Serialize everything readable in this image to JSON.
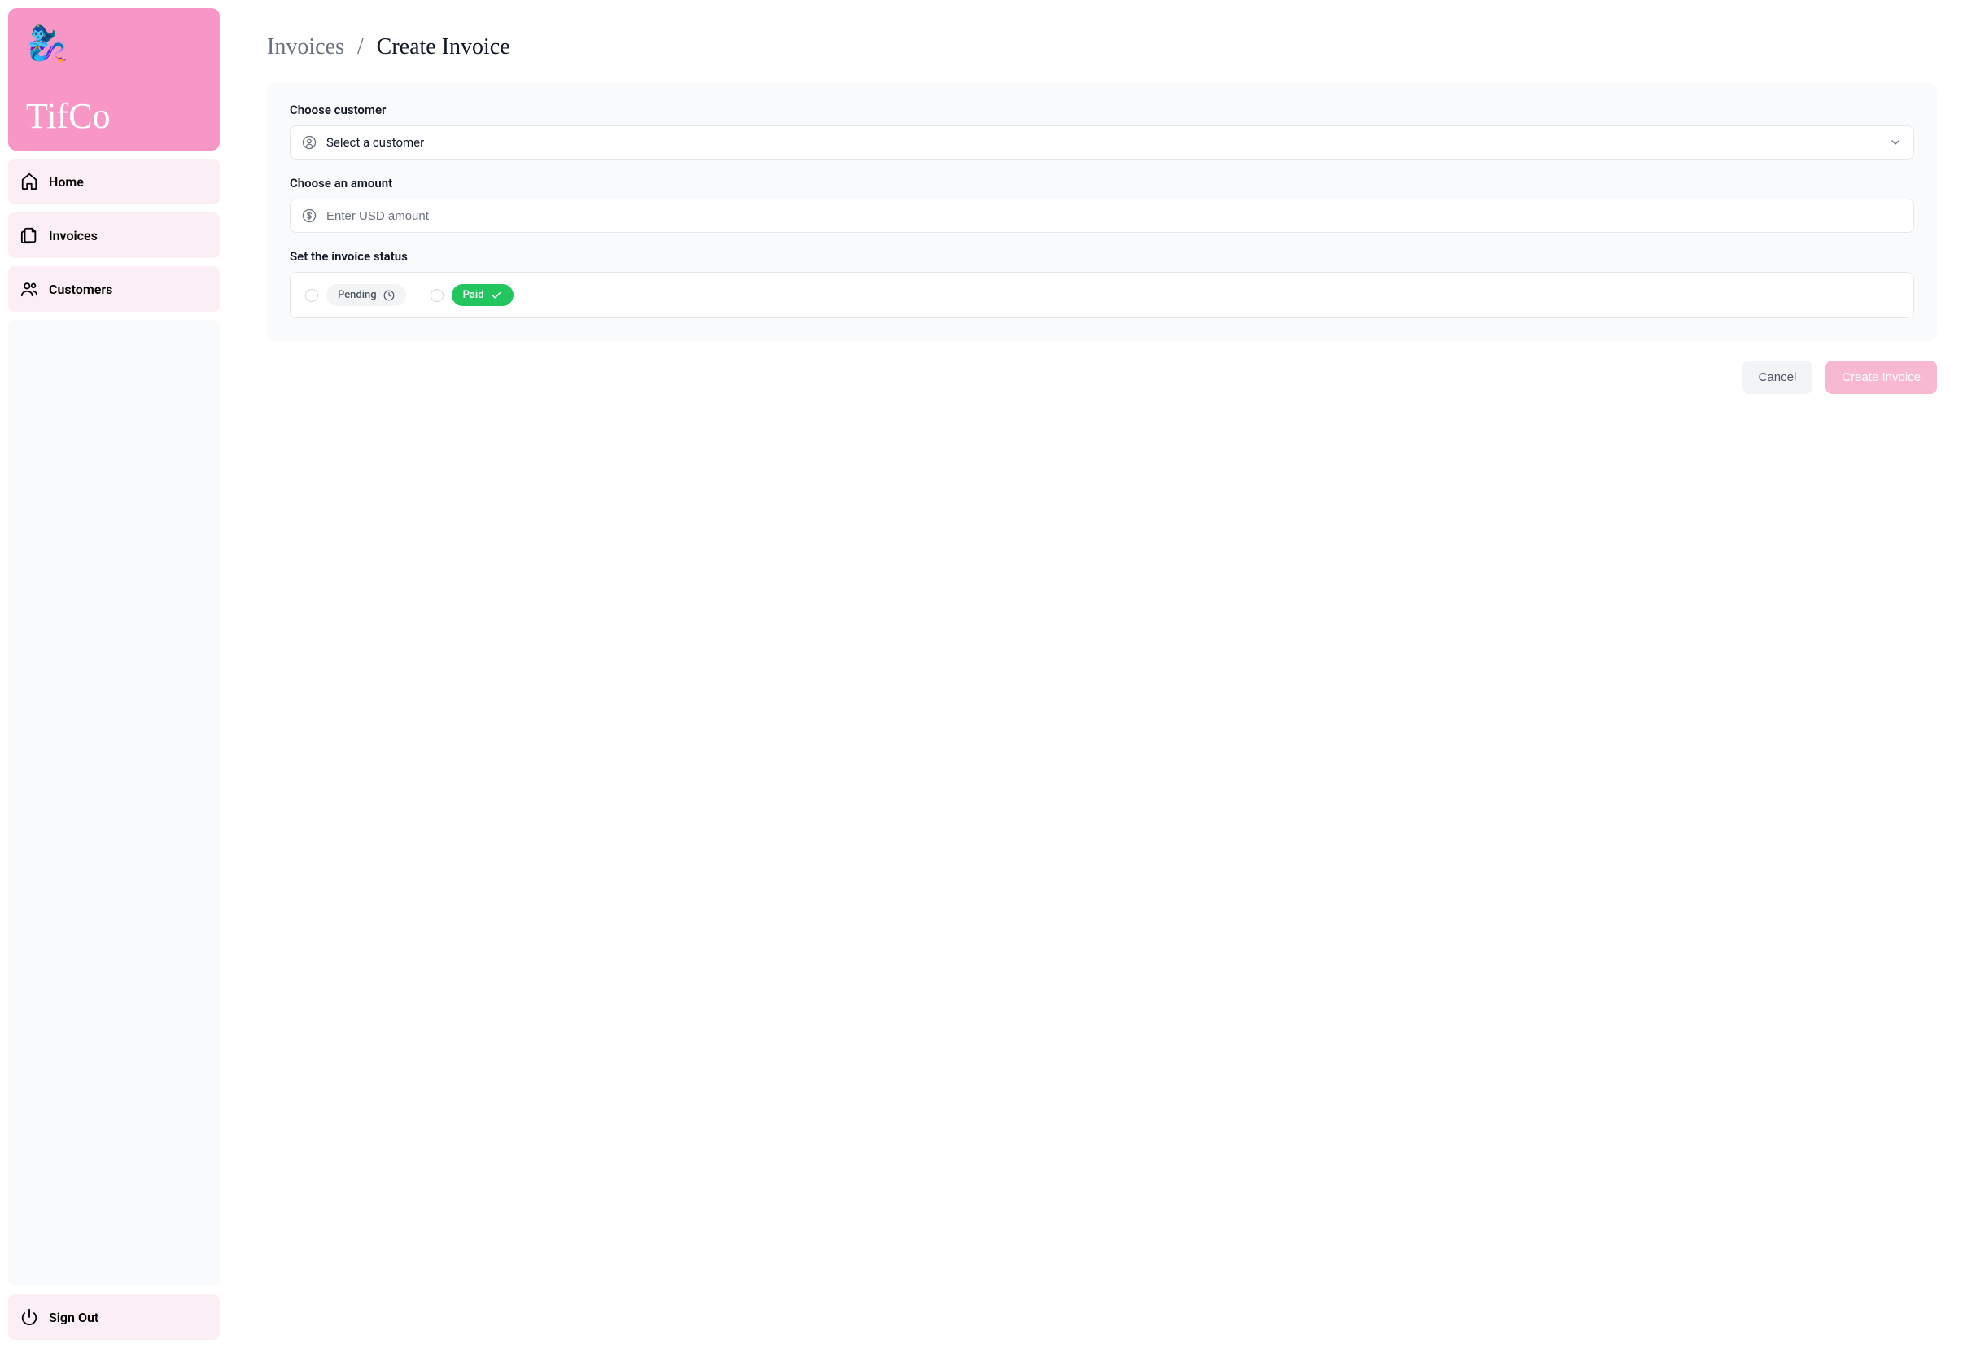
{
  "brand": {
    "name": "TifCo",
    "emoji": "🧞‍♀️"
  },
  "sidebar": {
    "items": [
      {
        "label": "Home"
      },
      {
        "label": "Invoices"
      },
      {
        "label": "Customers"
      }
    ],
    "signout": "Sign Out"
  },
  "breadcrumb": {
    "parent": "Invoices",
    "separator": "/",
    "current": "Create Invoice"
  },
  "form": {
    "customer": {
      "label": "Choose customer",
      "placeholder": "Select a customer"
    },
    "amount": {
      "label": "Choose an amount",
      "placeholder": "Enter USD amount"
    },
    "status": {
      "label": "Set the invoice status",
      "pending": "Pending",
      "paid": "Paid"
    }
  },
  "actions": {
    "cancel": "Cancel",
    "submit": "Create Invoice"
  }
}
